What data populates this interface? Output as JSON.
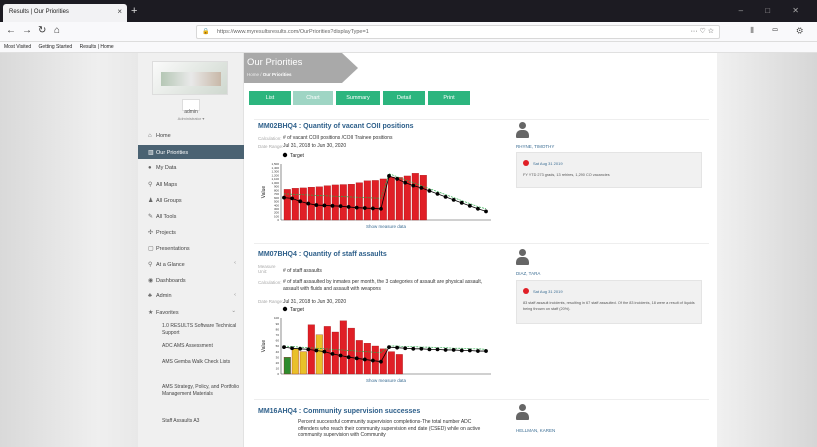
{
  "browser": {
    "tab_title": "Results | Our Priorities",
    "url": "https://www.myresultsresults.com/OurPriorities?displayType=1",
    "bookmarks": [
      "Most Visited",
      "Getting Started",
      "Results | Home"
    ]
  },
  "sidebar": {
    "user_name": "admin",
    "user_role": "Administrator ▾",
    "items": [
      {
        "label": "Home",
        "icon": "home-icon"
      },
      {
        "label": "Our Priorities",
        "icon": "chart-icon",
        "active": true
      },
      {
        "label": "My Data",
        "icon": "user-icon"
      },
      {
        "label": "All Maps",
        "icon": "map-icon"
      },
      {
        "label": "All Groups",
        "icon": "group-icon"
      },
      {
        "label": "All Tools",
        "icon": "wrench-icon"
      },
      {
        "label": "Projects",
        "icon": "puzzle-icon"
      },
      {
        "label": "Presentations",
        "icon": "slides-icon"
      },
      {
        "label": "At a Glance",
        "icon": "search-icon"
      },
      {
        "label": "Dashboards",
        "icon": "dashboard-icon"
      },
      {
        "label": "Admin",
        "icon": "admin-icon"
      },
      {
        "label": "Favorites",
        "icon": "star-icon"
      }
    ],
    "favorites": [
      "1.0 RESULTS Software Technical Support",
      "ADC AMS Assessment",
      "AMS Gemba Walk Check Lists",
      "AMS Strategy, Policy, and Portfolio Management Materials",
      "Staff Assaults A3"
    ]
  },
  "page": {
    "title": "Our Priorities",
    "breadcrumb_home": "Home",
    "breadcrumb_current": "Our Priorities",
    "tabs": [
      "List",
      "Chart",
      "Summary",
      "Detail",
      "Print"
    ],
    "active_tab": "Chart"
  },
  "cards": [
    {
      "title": "MM02BHQ4 : Quantity of vacant COII positions",
      "calc_label": "Calculation:",
      "calc_value": "# of vacant COII positions /COII Trainee positions",
      "date_label": "Date Range:",
      "date_value": "Jul 31, 2018 to Jun 30, 2020",
      "legend_target": "Target",
      "show_data": "Show measure data",
      "y_axis_label": "Value",
      "owner": "RHYNE, TIMOTHY",
      "comment_date": "Sat Aug 31 2019",
      "comment_text": "FY YTD 273 grads, 13 rehires, 1,290 CO vacancies",
      "chart": {
        "type": "bar",
        "y_ticks": [
          "1,500",
          "1,400",
          "1,300",
          "1,200",
          "1,100",
          "1,000",
          "900",
          "800",
          "700",
          "600",
          "500",
          "400",
          "300",
          "200",
          "100",
          "0"
        ],
        "bars": [
          820,
          850,
          860,
          880,
          890,
          920,
          940,
          950,
          960,
          1000,
          1050,
          1060,
          1100,
          1150,
          1140,
          1180,
          1250,
          1200
        ],
        "bar_colors": [
          "#e01f26"
        ],
        "actual": [
          600,
          580,
          500,
          440,
          400,
          390,
          380,
          370,
          350,
          330,
          320,
          310,
          300,
          1180,
          1100,
          1000,
          920,
          860,
          780,
          700,
          620,
          540,
          460,
          380,
          300,
          230
        ],
        "target": [
          700,
          690,
          680,
          670,
          660,
          650,
          640,
          630,
          620,
          610,
          600,
          590,
          580,
          1240,
          1160,
          1080,
          1000,
          920,
          840,
          760,
          680,
          600,
          520,
          440,
          360,
          300
        ],
        "ymax": 1500
      }
    },
    {
      "title": "MM07BHQ4 : Quantity of staff assaults",
      "measure_label": "Measure Unit:",
      "measure_value": "# of staff assaults",
      "calc_label": "Calculation:",
      "calc_value": "# of staff assaulted by inmates per month, the 3 categories of assault are physical assault, assault with fluids and assault with weapons",
      "date_label": "Date Range:",
      "date_value": "Jul 31, 2018 to Jun 30, 2020",
      "legend_target": "Target",
      "show_data": "Show measure data",
      "y_axis_label": "Value",
      "owner": "DIAZ, TARA",
      "comment_date": "Sat Aug 31 2019",
      "comment_text": "83 staff assault incidents, resulting in 67 staff assaulted. Of the 83 incidents, 18 were a result of liquids being thrown on staff (20%).",
      "chart": {
        "type": "bar",
        "y_ticks": [
          "100",
          "90",
          "80",
          "70",
          "60",
          "50",
          "40",
          "30",
          "20",
          "10",
          "0"
        ],
        "bars": [
          30,
          45,
          40,
          88,
          70,
          85,
          75,
          95,
          82,
          60,
          55,
          50,
          45,
          40,
          35
        ],
        "bar_colors": [
          "#2e8b2e",
          "#e8c02a",
          "#e8c02a",
          "#e01f26",
          "#e8c02a",
          "#e01f26",
          "#e01f26",
          "#e01f26",
          "#e01f26",
          "#e01f26",
          "#e01f26",
          "#e01f26",
          "#e01f26",
          "#e01f26",
          "#e01f26"
        ],
        "actual": [
          48,
          46,
          45,
          44,
          42,
          40,
          36,
          33,
          30,
          28,
          26,
          24,
          22,
          48,
          47,
          46,
          45,
          45,
          44,
          44,
          43,
          43,
          42,
          42,
          41,
          41
        ],
        "target": [
          50,
          49,
          48,
          47,
          46,
          45,
          44,
          43,
          42,
          41,
          40,
          39,
          38,
          50,
          50,
          49,
          49,
          48,
          48,
          47,
          47,
          46,
          46,
          45,
          45,
          44
        ],
        "ymax": 100
      }
    },
    {
      "title": "MM16AHQ4 : Community supervision successes",
      "calc_value": "Percent successful community supervision completions-The total number ADC offenders who reach their community supervision end date (CSED) while on active community supervision with Community",
      "owner": "HELLMAN, KAREN"
    }
  ]
}
